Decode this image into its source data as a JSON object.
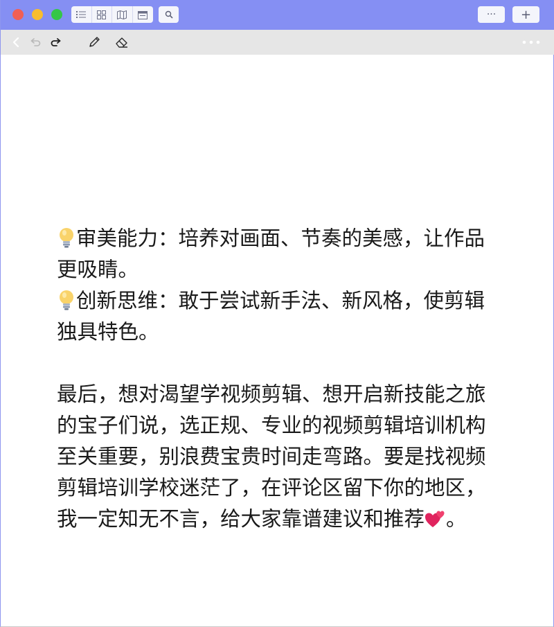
{
  "titlebar": {
    "traffic_lights": [
      "close",
      "minimize",
      "zoom"
    ],
    "view_buttons": [
      "list-view-icon",
      "grid-view-icon",
      "map-view-icon",
      "calendar-view-icon"
    ],
    "search_icon": "search-icon",
    "more_label": "···",
    "add_label": "+"
  },
  "toolbar": {
    "icons": [
      "back-icon",
      "undo-icon",
      "redo-icon",
      "pencil-icon",
      "eraser-icon",
      "more-dots-icon"
    ]
  },
  "note": {
    "line1_text": "审美能力：培养对画面、节奏的美感，让作品更吸睛。",
    "line2_text": "创新思维：敢于尝试新手法、新风格，使剪辑独具特色。",
    "para_text": "最后，想对渴望学视频剪辑、想开启新技能之旅的宝子们说，选正规、专业的视频剪辑培训机构至关重要，别浪费宝贵时间走弯路。要是找视频剪辑培训学校迷茫了，在评论区留下你的地区，我一定知无不言，给大家靠谱建议和推荐",
    "para_end": "。",
    "emoji_bulb": "light-bulb-emoji",
    "emoji_hearts": "two-hearts-emoji"
  },
  "colors": {
    "titlebar_bg": "#858ff3",
    "toolbar_bg": "#e6e6e6",
    "text": "#1a1a1a"
  }
}
